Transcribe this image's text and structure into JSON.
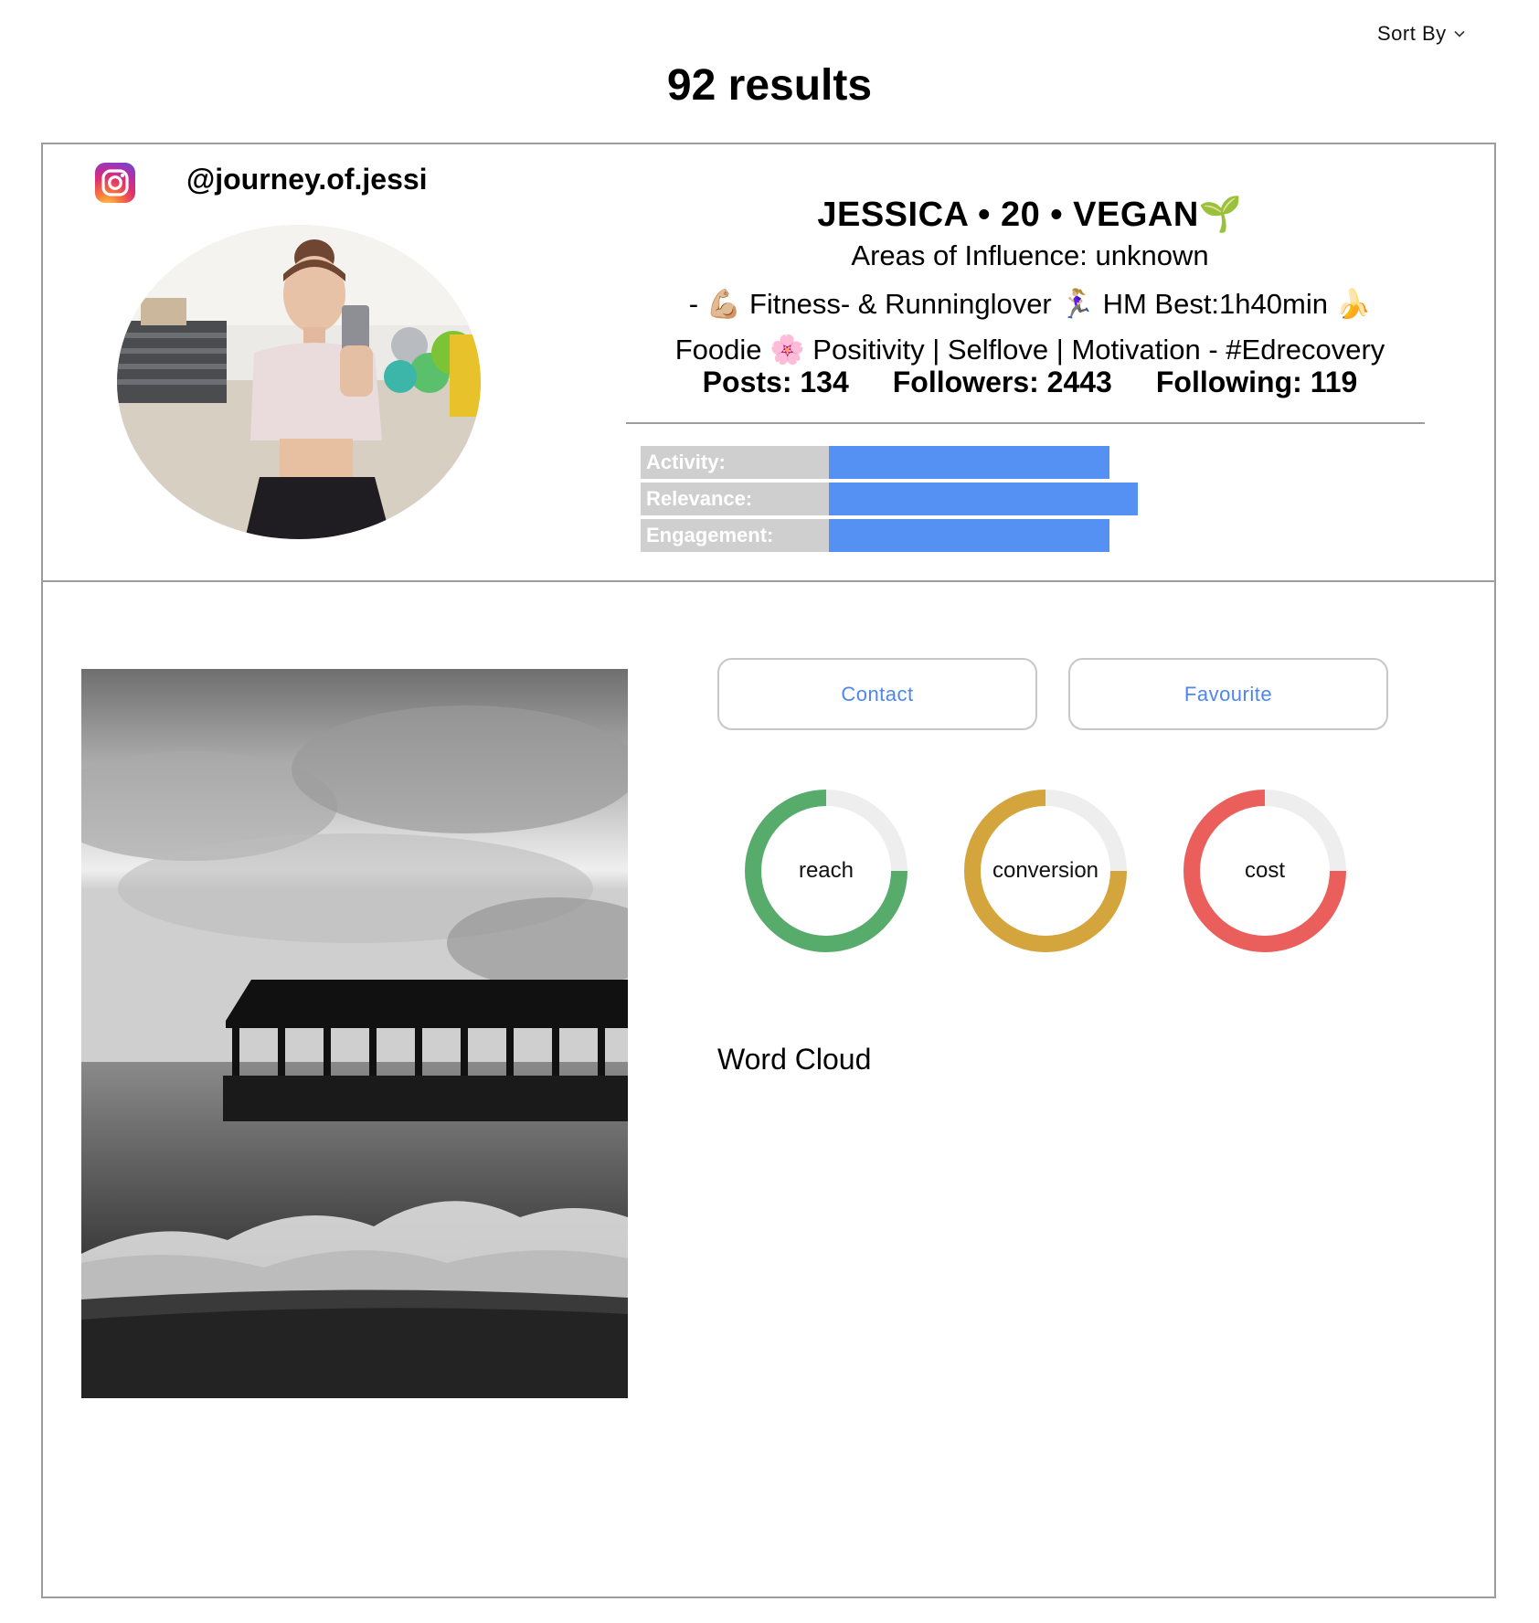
{
  "header": {
    "sort_label": "Sort By",
    "results_title": "92 results"
  },
  "profile": {
    "platform_icon": "instagram-icon",
    "handle": "@journey.of.jessi",
    "name_line": "JESSICA • 20 • VEGAN🌱",
    "areas_of_influence": "Areas of Influence: unknown",
    "bio_line_1": "- 💪🏼 Fitness- & Runninglover 🏃🏼‍♀️ HM Best:1h40min 🍌",
    "bio_line_2": "Foodie 🌸 Positivity | Selflove | Motivation - #Edrecovery",
    "stats": {
      "posts": "Posts: 134",
      "followers": "Followers: 2443",
      "following": "Following: 119"
    },
    "metrics": [
      {
        "label": "Activity:",
        "level": 0.6,
        "color": "#5590f3"
      },
      {
        "label": "Relevance:",
        "level": 0.66,
        "color": "#5590f3"
      },
      {
        "label": "Engagement:",
        "level": 0.6,
        "color": "#5590f3"
      }
    ]
  },
  "actions": {
    "contact_label": "Contact",
    "favourite_label": "Favourite"
  },
  "gauges": [
    {
      "label": "reach",
      "level": 0.75,
      "color": "#57ab6b"
    },
    {
      "label": "conversion",
      "level": 0.75,
      "color": "#d3a53c"
    },
    {
      "label": "cost",
      "level": 0.75,
      "color": "#ea5f5b"
    }
  ],
  "word_cloud": {
    "title": "Word Cloud"
  }
}
